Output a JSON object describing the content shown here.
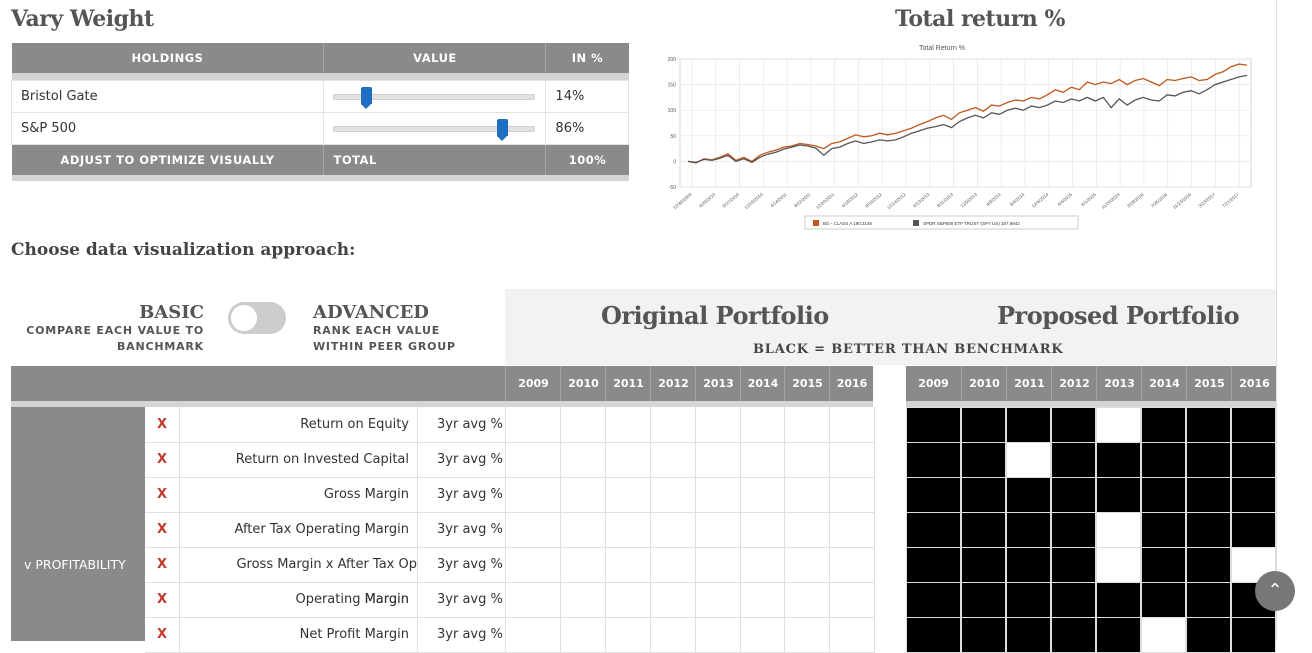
{
  "vary_weight": {
    "title": "Vary Weight",
    "col_holdings": "HOLDINGS",
    "col_value": "VALUE",
    "col_pct": "IN %",
    "rows": [
      {
        "name": "Bristol Gate",
        "pct": "14%",
        "weight": 0.14
      },
      {
        "name": "S&P 500",
        "pct": "86%",
        "weight": 0.86
      }
    ],
    "footer_label": "ADJUST TO OPTIMIZE VISUALLY",
    "footer_total": "TOTAL",
    "footer_pct": "100%"
  },
  "total_return": {
    "title": "Total return %"
  },
  "chart_data": {
    "type": "line",
    "title": "Total Return %",
    "ylim": [
      -50,
      200
    ],
    "yticks": [
      -50,
      0,
      50,
      100,
      150,
      200
    ],
    "x_ticks": [
      "12/30/2009",
      "4/29/2010",
      "8/27/2010",
      "12/25/2010",
      "4/24/2011",
      "8/22/2011",
      "12/20/2011",
      "4/18/2012",
      "8/16/2012",
      "12/14/2012",
      "4/13/2013",
      "8/11/2013",
      "12/9/2013",
      "4/8/2014",
      "8/6/2014",
      "12/4/2014",
      "4/4/2015",
      "8/1/2015",
      "11/29/2015",
      "3/28/2016",
      "7/26/2016",
      "11/23/2016",
      "3/23/2017",
      "7/21/2017"
    ],
    "grid": true,
    "legend_position": "bottom",
    "series": [
      {
        "name": "BG - CLASS A 190.3146",
        "color": "#c0571c",
        "values": [
          0,
          -3,
          5,
          3,
          8,
          15,
          2,
          8,
          0,
          12,
          18,
          22,
          28,
          30,
          35,
          33,
          30,
          25,
          35,
          38,
          45,
          52,
          48,
          50,
          55,
          52,
          55,
          60,
          65,
          72,
          78,
          85,
          90,
          82,
          95,
          100,
          105,
          98,
          110,
          108,
          115,
          120,
          118,
          125,
          122,
          130,
          140,
          135,
          145,
          140,
          155,
          150,
          155,
          152,
          160,
          150,
          158,
          162,
          155,
          148,
          160,
          158,
          162,
          165,
          158,
          160,
          170,
          175,
          185,
          190,
          188
        ]
      },
      {
        "name": "SPDR S&P500 ETF TRUST (SPY US) 167.9842",
        "color": "#555555",
        "values": [
          0,
          -2,
          4,
          2,
          6,
          12,
          0,
          5,
          -2,
          8,
          14,
          18,
          24,
          28,
          32,
          30,
          26,
          12,
          25,
          28,
          35,
          40,
          35,
          38,
          42,
          40,
          42,
          48,
          55,
          60,
          65,
          68,
          72,
          66,
          78,
          85,
          90,
          85,
          95,
          92,
          100,
          104,
          100,
          108,
          105,
          110,
          118,
          115,
          122,
          118,
          125,
          118,
          125,
          105,
          122,
          110,
          120,
          125,
          120,
          118,
          130,
          128,
          135,
          138,
          132,
          140,
          150,
          155,
          160,
          165,
          168
        ]
      }
    ]
  },
  "viz": {
    "heading": "Choose data visualization approach:",
    "basic_title": "BASIC",
    "basic_sub": "COMPARE EACH VALUE TO BANCHMARK",
    "advanced_title": "ADVANCED",
    "advanced_sub": "RANK EACH VALUE WITHIN PEER GROUP"
  },
  "portfolio": {
    "original_title": "Original Portfolio",
    "proposed_title": "Proposed Portfolio",
    "note": "BLACK = BETTER THAN BENCHMARK",
    "years": [
      "2009",
      "2010",
      "2011",
      "2012",
      "2013",
      "2014",
      "2015",
      "2016"
    ],
    "group_label": "v PROFITABILITY",
    "metrics": [
      {
        "x": "X",
        "name": "Return on Equity",
        "period": "3yr avg %",
        "proposed": [
          1,
          1,
          1,
          1,
          0,
          1,
          1,
          1
        ]
      },
      {
        "x": "X",
        "name": "Return on Invested Capital",
        "period": "3yr avg %",
        "proposed": [
          1,
          1,
          0,
          1,
          1,
          1,
          1,
          1
        ]
      },
      {
        "x": "X",
        "name": "Gross Margin",
        "period": "3yr avg %",
        "proposed": [
          1,
          1,
          1,
          1,
          1,
          1,
          1,
          1
        ]
      },
      {
        "x": "X",
        "name": "After Tax Operating Margin",
        "period": "3yr avg %",
        "proposed": [
          1,
          1,
          1,
          1,
          0,
          1,
          1,
          1
        ]
      },
      {
        "x": "X",
        "name": "Gross Margin x After Tax Op Margin",
        "period": "3yr avg %",
        "proposed": [
          1,
          1,
          1,
          1,
          0,
          1,
          1,
          0
        ]
      },
      {
        "x": "X",
        "name": "Operating Margin",
        "period": "3yr avg %",
        "proposed": [
          1,
          1,
          1,
          1,
          1,
          1,
          1,
          1
        ]
      },
      {
        "x": "X",
        "name": "Net Profit Margin",
        "period": "3yr avg %",
        "proposed": [
          1,
          1,
          1,
          1,
          1,
          0,
          1,
          1
        ]
      }
    ]
  },
  "scroll_top_icon": "chevron-up-icon"
}
